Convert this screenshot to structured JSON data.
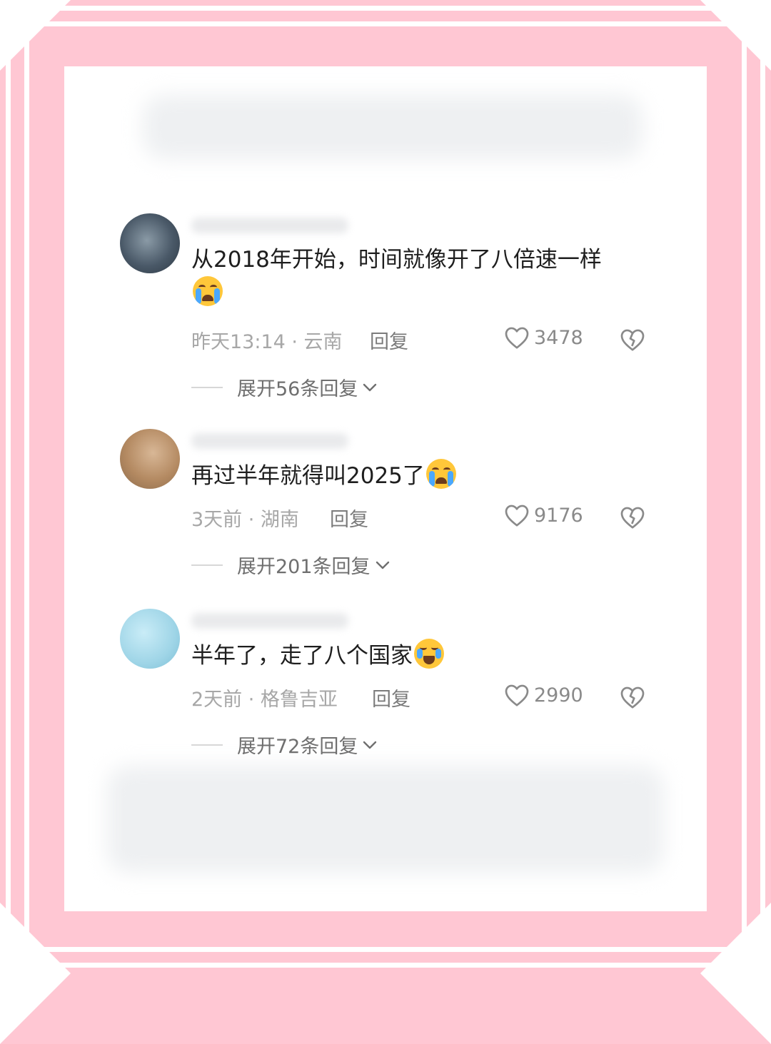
{
  "comments": [
    {
      "text": "从2018年开始，时间就像开了八倍速一样",
      "emoji": "loudly-crying-face",
      "meta": "昨天13:14 · 云南",
      "reply_label": "回复",
      "likes": "3478",
      "expand": "展开56条回复"
    },
    {
      "text": "再过半年就得叫2025了",
      "emoji": "loudly-crying-face",
      "meta": "3天前 · 湖南",
      "reply_label": "回复",
      "likes": "9176",
      "expand": "展开201条回复"
    },
    {
      "text": "半年了，走了八个国家",
      "emoji": "tears-of-joy-face",
      "meta": "2天前 · 格鲁吉亚",
      "reply_label": "回复",
      "likes": "2990",
      "expand": "展开72条回复"
    }
  ],
  "colors": {
    "frame_pink": "#ffc7d3",
    "text": "#1e1e1e",
    "meta": "#a7a7a7",
    "icon": "#8a8a8a"
  },
  "icons": [
    "heart-outline-icon",
    "broken-heart-icon",
    "chevron-down-icon"
  ]
}
